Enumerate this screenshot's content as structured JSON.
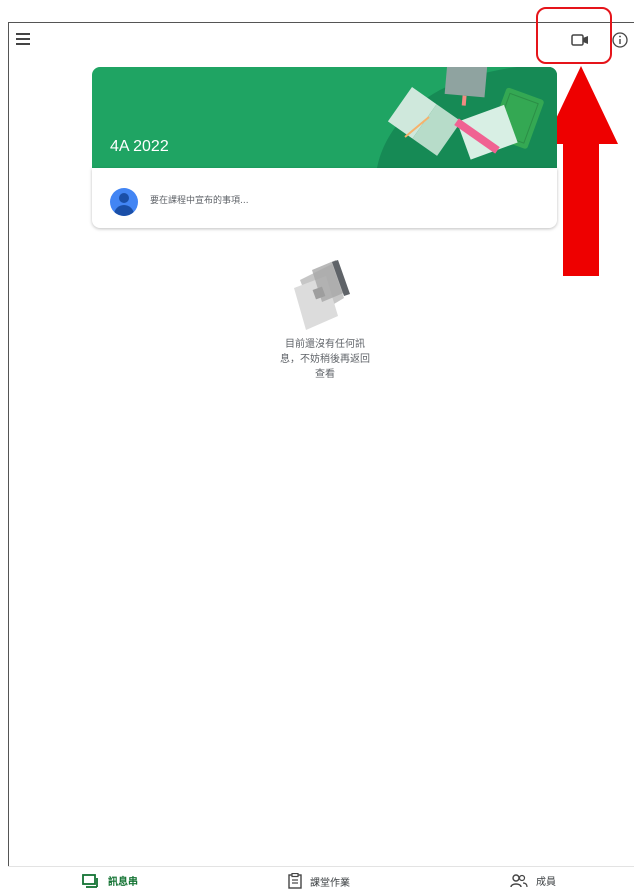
{
  "course": {
    "name": "4A 2022",
    "banner_color": "#1fa463"
  },
  "announce": {
    "placeholder": "要在課程中宣布的事項..."
  },
  "empty_state": {
    "line1": "目前還沒有任何訊",
    "line2": "息，不妨稍後再返回",
    "line3": "查看"
  },
  "nav": {
    "stream": "訊息串",
    "classwork": "課堂作業",
    "people": "成員"
  },
  "colors": {
    "accent": "#137333",
    "highlight": "#e5141a"
  },
  "icons": {
    "menu": "menu-icon",
    "video": "video-camera-icon",
    "info": "info-icon"
  }
}
